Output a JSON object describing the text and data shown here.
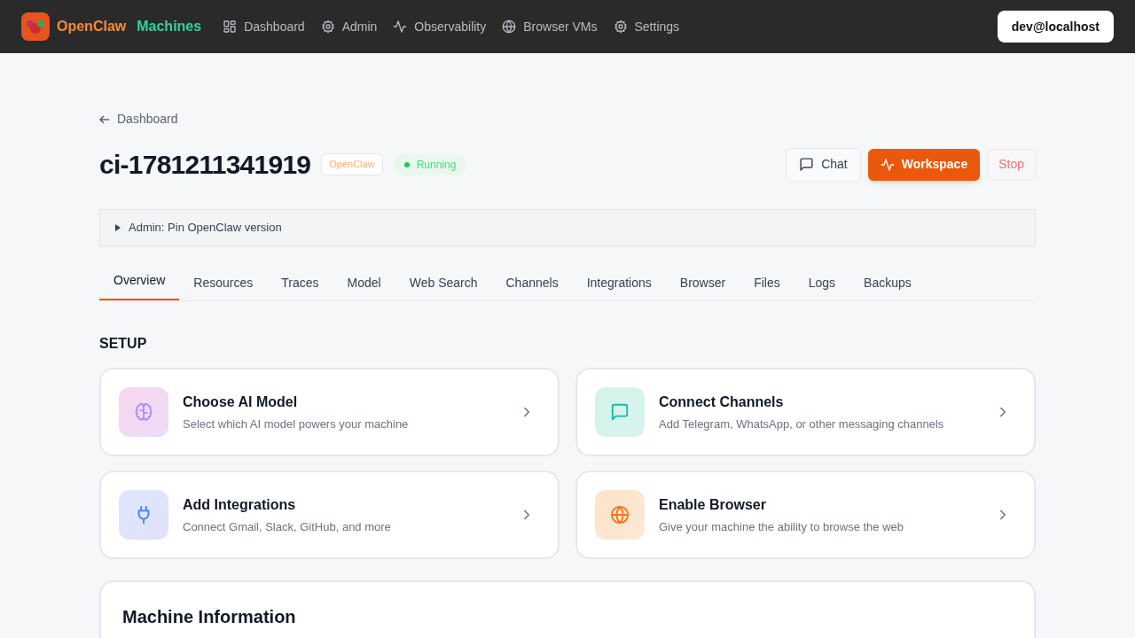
{
  "nav": {
    "brand": "OpenClaw",
    "product": "Machines",
    "items": [
      {
        "label": "Dashboard",
        "kind": "grid"
      },
      {
        "label": "Admin",
        "kind": "gear"
      },
      {
        "label": "Observability",
        "kind": "pulse"
      },
      {
        "label": "Browser VMs",
        "kind": "globe"
      },
      {
        "label": "Settings",
        "kind": "gear"
      }
    ],
    "user": "dev@localhost"
  },
  "back_link": "Dashboard",
  "machine": {
    "name": "ci-1781211341919",
    "tag": "OpenClaw",
    "status": "Running",
    "running": true
  },
  "actions": [
    {
      "label": "Chat",
      "kind": "chat"
    },
    {
      "label": "Workspace",
      "kind": "primary"
    },
    {
      "label": "Stop",
      "kind": "danger"
    }
  ],
  "admin_pin": {
    "label": "Admin: Pin OpenClaw version",
    "expanded": false
  },
  "tabs": [
    {
      "label": "Overview",
      "selected": true
    },
    {
      "label": "Resources",
      "selected": false
    },
    {
      "label": "Traces",
      "selected": false
    },
    {
      "label": "Model",
      "selected": false
    },
    {
      "label": "Web Search",
      "selected": false
    },
    {
      "label": "Channels",
      "selected": false
    },
    {
      "label": "Integrations",
      "selected": false
    },
    {
      "label": "Browser",
      "selected": false
    },
    {
      "label": "Files",
      "selected": false
    },
    {
      "label": "Logs",
      "selected": false
    },
    {
      "label": "Backups",
      "selected": false
    }
  ],
  "setup": {
    "heading": "SETUP",
    "cards": [
      {
        "kind": "model",
        "title": "Choose AI Model",
        "description": "Select which AI model powers your machine"
      },
      {
        "kind": "channels",
        "title": "Connect Channels",
        "description": "Add Telegram, WhatsApp, or other messaging channels"
      },
      {
        "kind": "integrations",
        "title": "Add Integrations",
        "description": "Connect Gmail, Slack, GitHub, and more"
      },
      {
        "kind": "browser",
        "title": "Enable Browser",
        "description": "Give your machine the ability to browse the web"
      }
    ]
  },
  "machine_info": {
    "title": "Machine Information"
  }
}
